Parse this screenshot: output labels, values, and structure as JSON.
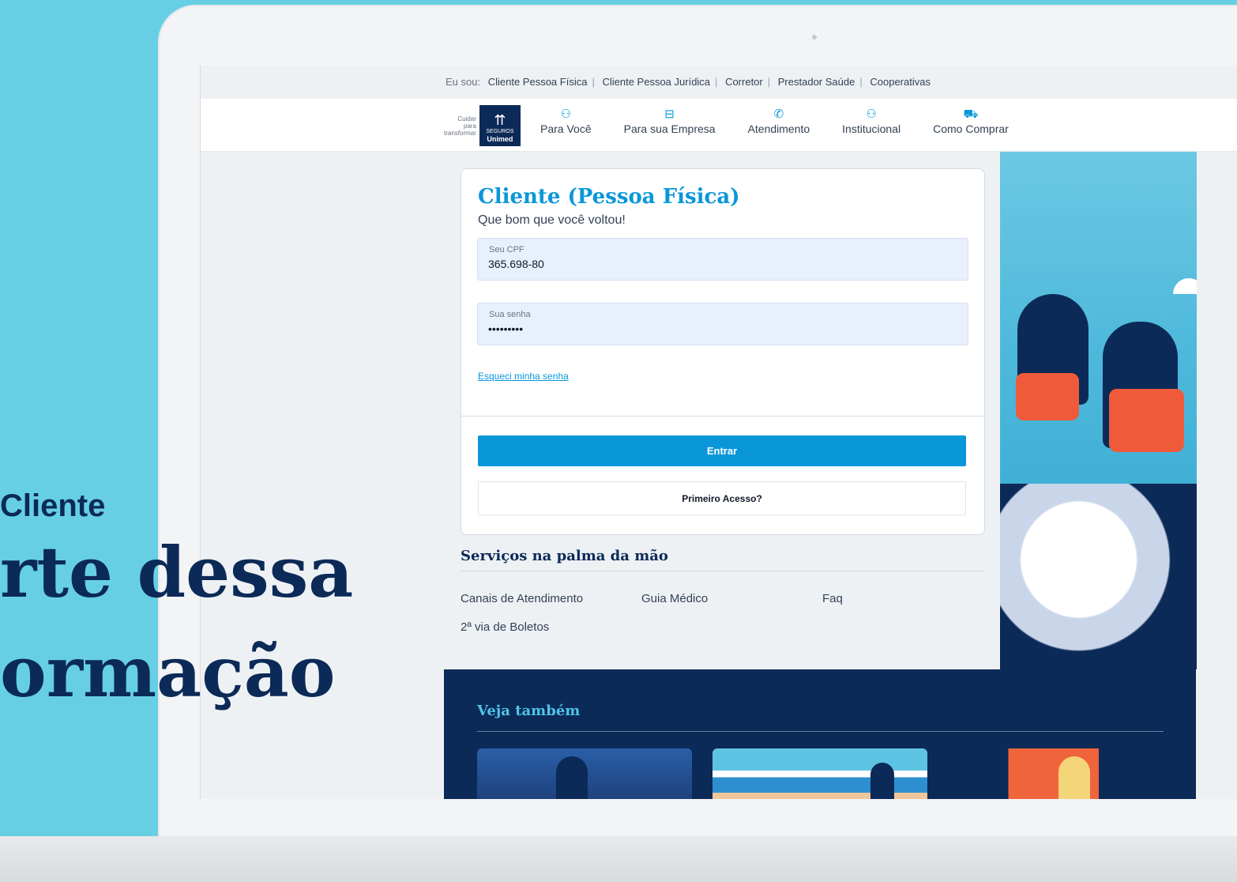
{
  "promo": {
    "sub": "Cliente",
    "line1": "rte dessa",
    "line2": "ormação"
  },
  "topbar": {
    "label": "Eu sou:",
    "links": [
      "Cliente Pessoa Física",
      "Cliente Pessoa Jurídica",
      "Corretor",
      "Prestador Saúde",
      "Cooperativas"
    ]
  },
  "logo": {
    "tagline": [
      "Cuidar",
      "para",
      "transformar"
    ],
    "brand_line1": "SEGUROS",
    "brand_line2": "Unimed"
  },
  "nav": {
    "items": [
      {
        "label": "Para Você",
        "icon": "people-icon"
      },
      {
        "label": "Para sua Empresa",
        "icon": "briefcase-icon"
      },
      {
        "label": "Atendimento",
        "icon": "phone-icon"
      },
      {
        "label": "Institucional",
        "icon": "people-icon"
      },
      {
        "label": "Como Comprar",
        "icon": "cart-icon"
      }
    ]
  },
  "login": {
    "title": "Cliente (Pessoa Física)",
    "greeting": "Que bom que você voltou!",
    "cpf_label": "Seu CPF",
    "cpf_value": "365.698-80",
    "password_label": "Sua senha",
    "password_value": "•••••••••",
    "forgot": "Esqueci minha senha",
    "submit": "Entrar",
    "first_access": "Primeiro Acesso?"
  },
  "services": {
    "title": "Serviços na palma da mão",
    "links": [
      "Canais de Atendimento",
      "Guia Médico",
      "Faq",
      "2ª via de Boletos"
    ]
  },
  "footer": {
    "title": "Veja também"
  },
  "colors": {
    "accent": "#0a97d9",
    "navy": "#0b2a57",
    "background": "#67cfe3"
  }
}
